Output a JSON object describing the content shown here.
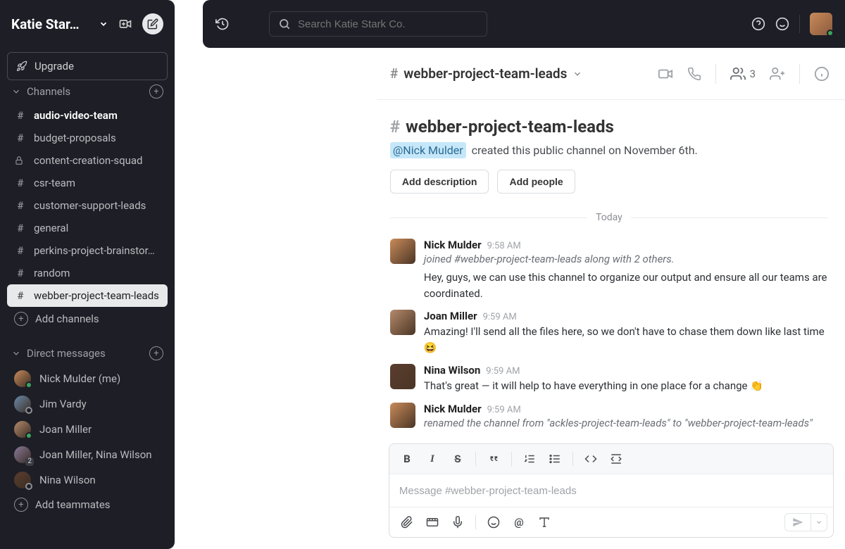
{
  "workspace": {
    "name": "Katie Star…"
  },
  "search": {
    "placeholder": "Search Katie Stark Co."
  },
  "upgrade": {
    "label": "Upgrade"
  },
  "sections": {
    "channels": "Channels",
    "dms": "Direct messages",
    "addChannels": "Add channels",
    "addTeammates": "Add teammates"
  },
  "channels": [
    {
      "name": "audio-video-team",
      "type": "hash",
      "bold": true
    },
    {
      "name": "budget-proposals",
      "type": "hash"
    },
    {
      "name": "content-creation-squad",
      "type": "lock"
    },
    {
      "name": "csr-team",
      "type": "hash"
    },
    {
      "name": "customer-support-leads",
      "type": "hash"
    },
    {
      "name": "general",
      "type": "hash"
    },
    {
      "name": "perkins-project-brainstor…",
      "type": "hash"
    },
    {
      "name": "random",
      "type": "hash"
    },
    {
      "name": "webber-project-team-leads",
      "type": "hash",
      "active": true
    }
  ],
  "dms": [
    {
      "name": "Nick Mulder (me)",
      "presence": "online",
      "color": "#c98b5a"
    },
    {
      "name": "Jim Vardy",
      "presence": "away",
      "color": "#6b8aa8"
    },
    {
      "name": "Joan Miller",
      "presence": "online",
      "color": "#b58a6b"
    },
    {
      "name": "Joan Miller, Nina Wilson",
      "presence": "group",
      "badge": "2",
      "color": "#8a7a9a"
    },
    {
      "name": "Nina Wilson",
      "presence": "away",
      "color": "#5a3d2e"
    }
  ],
  "header": {
    "channel": "webber-project-team-leads",
    "members": "3"
  },
  "intro": {
    "title": "webber-project-team-leads",
    "creator": "@Nick Mulder",
    "createdText": "created this public channel on November 6th.",
    "addDescription": "Add description",
    "addPeople": "Add people"
  },
  "divider": "Today",
  "messages": [
    {
      "author": "Nick Mulder",
      "time": "9:58 AM",
      "system": "joined #webber-project-team-leads along with 2 others.",
      "text": "Hey, guys, we can use this channel to organize our output and ensure all our teams are coordinated.",
      "color": "#c98b5a"
    },
    {
      "author": "Joan Miller",
      "time": "9:59 AM",
      "text": "Amazing! I'll send all the files here, so we don't have to chase them down like last time 😆",
      "color": "#b58a6b"
    },
    {
      "author": "Nina Wilson",
      "time": "9:59 AM",
      "text": "That's great — it will help to have everything in one place for a change 👏",
      "color": "#5a3d2e"
    },
    {
      "author": "Nick Mulder",
      "time": "9:59 AM",
      "system": "renamed the channel from \"ackles-project-team-leads\" to \"webber-project-team-leads\"",
      "color": "#c98b5a"
    }
  ],
  "composer": {
    "placeholder": "Message #webber-project-team-leads"
  }
}
